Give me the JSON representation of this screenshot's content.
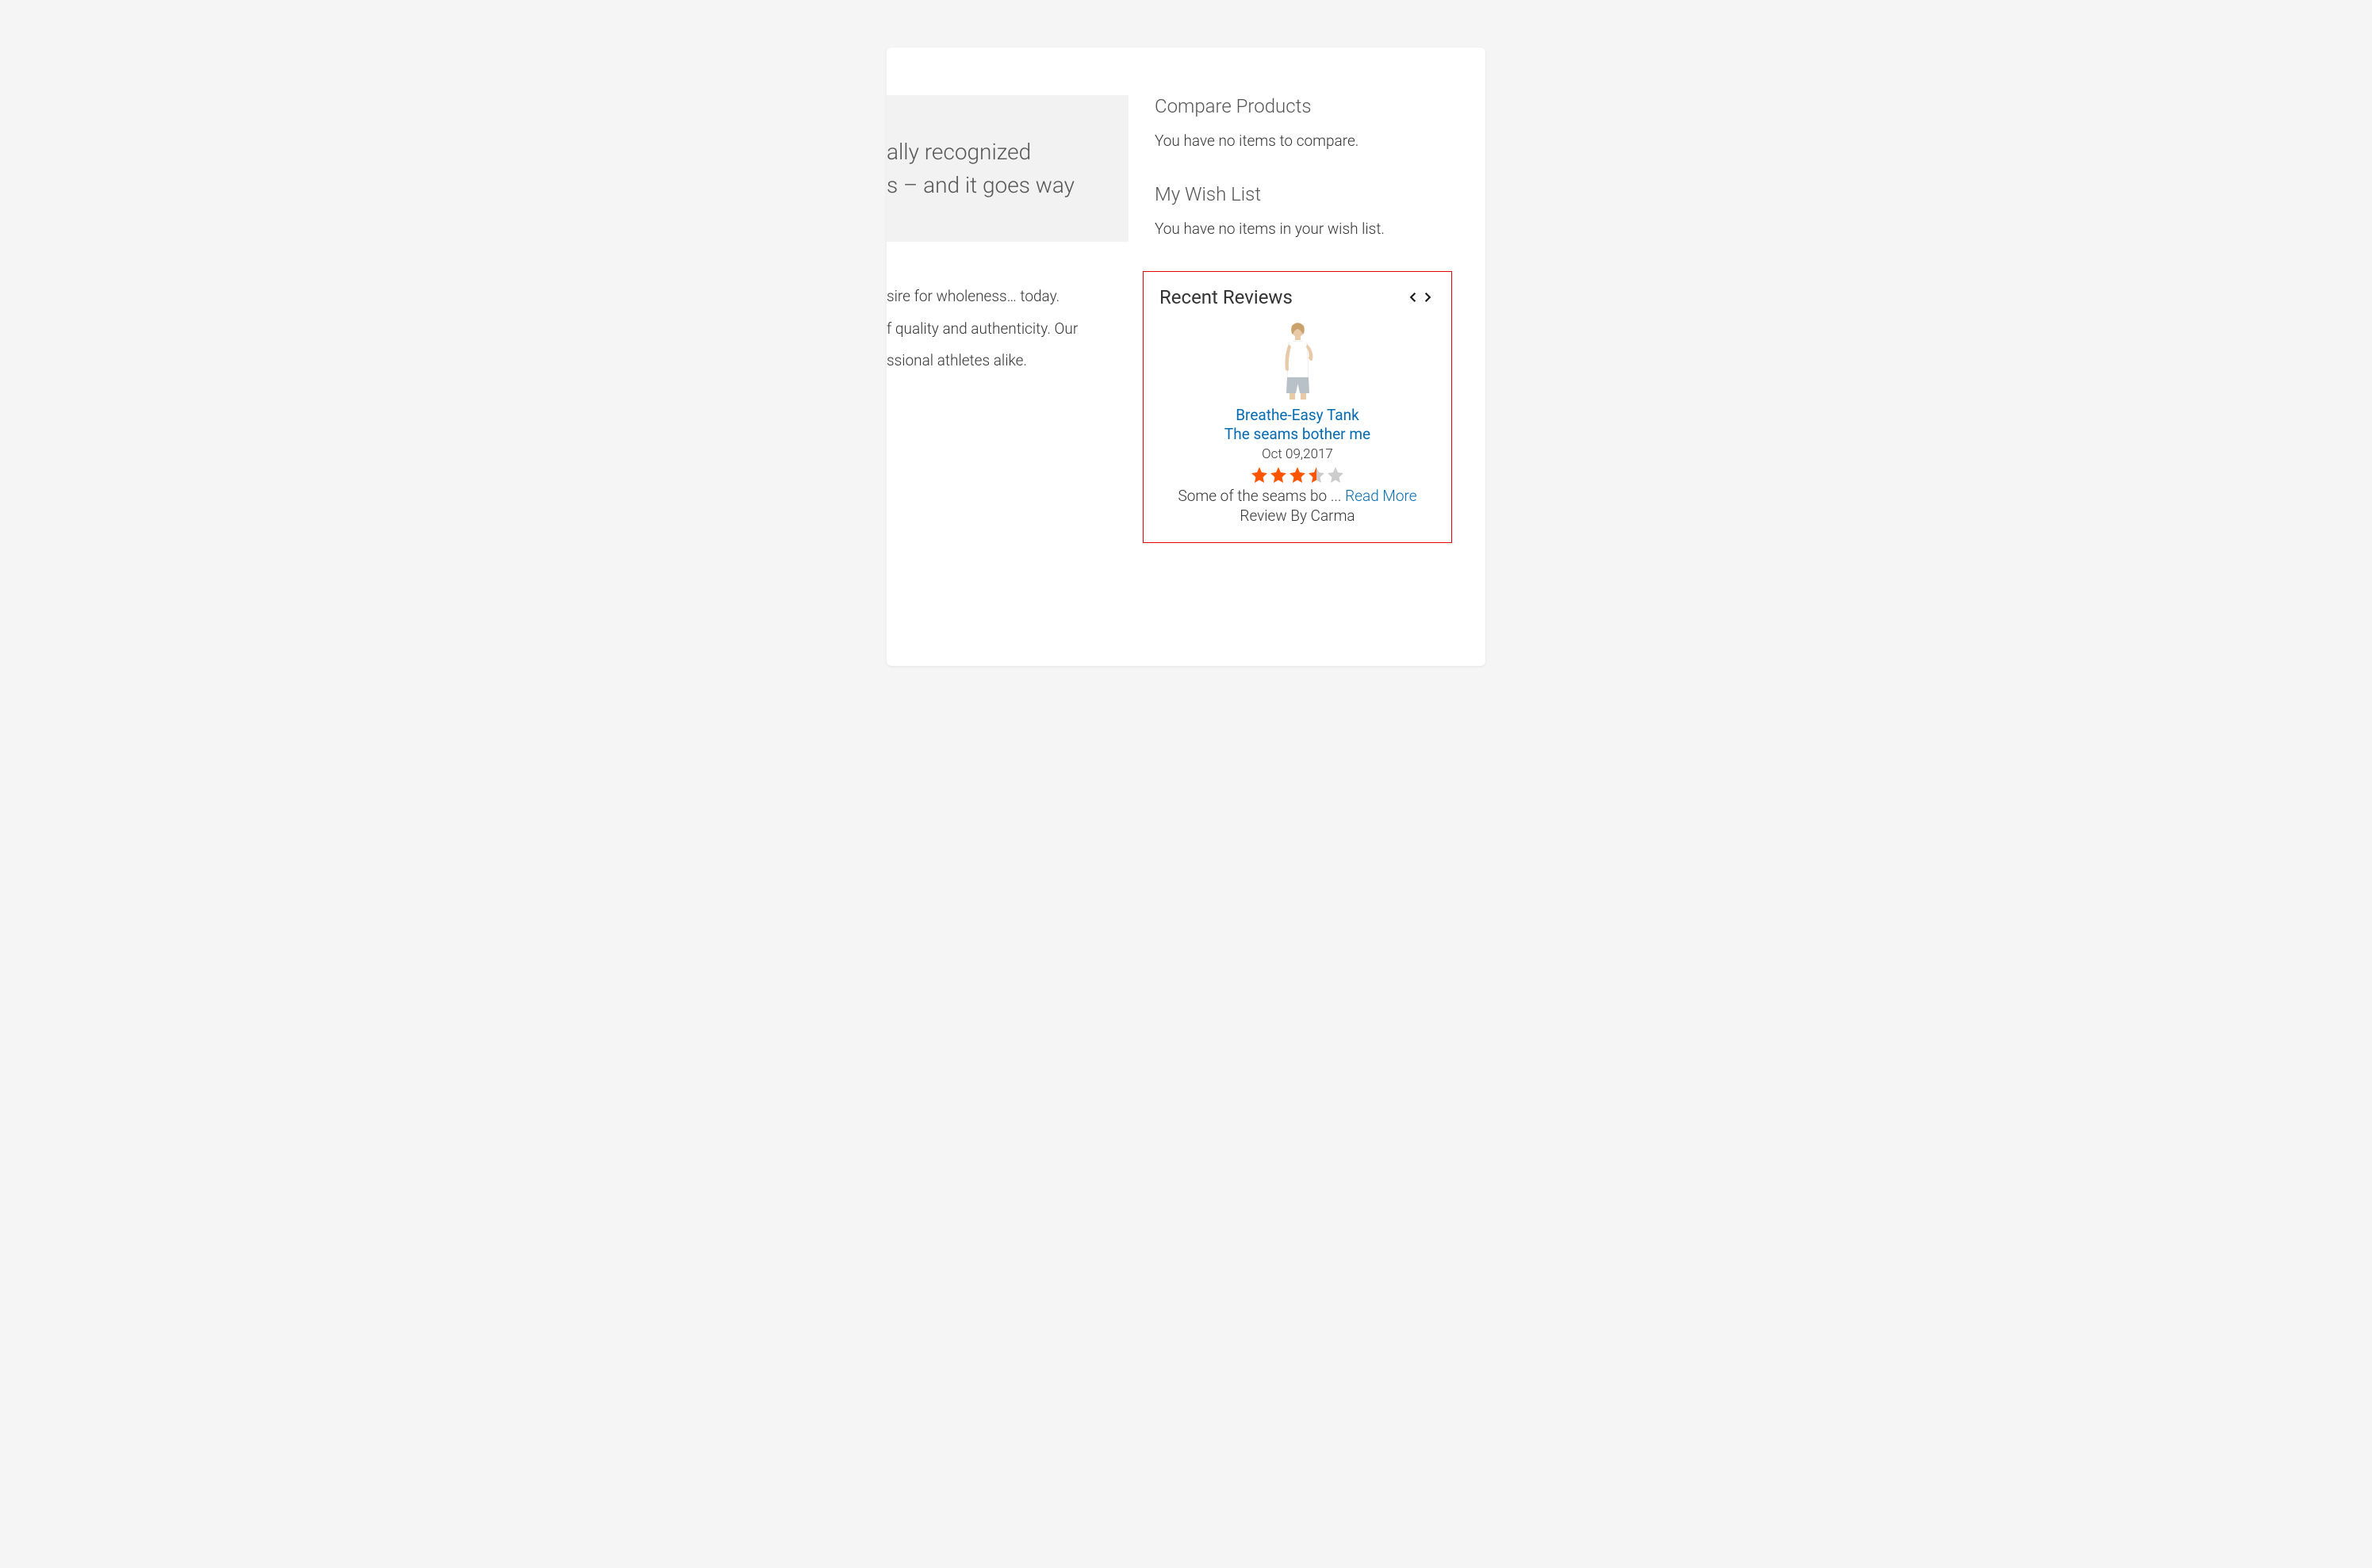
{
  "left": {
    "hero_line1": "ally recognized",
    "hero_line2": "s – and it goes way",
    "para1": "sire for wholeness… today.",
    "para2": "f quality and authenticity. Our",
    "para3": "ssional athletes alike."
  },
  "sidebar": {
    "compare": {
      "heading": "Compare Products",
      "message": "You have no items to compare."
    },
    "wishlist": {
      "heading": "My Wish List",
      "message": "You have no items in your wish list."
    },
    "recent_reviews": {
      "heading": "Recent Reviews",
      "product_name": "Breathe-Easy Tank",
      "review_title": "The seams bother me",
      "date": "Oct 09,2017",
      "rating": 3.5,
      "snippet": "Some of the seams bo ... ",
      "read_more": "Read More",
      "reviewer": "Review By Carma"
    }
  }
}
